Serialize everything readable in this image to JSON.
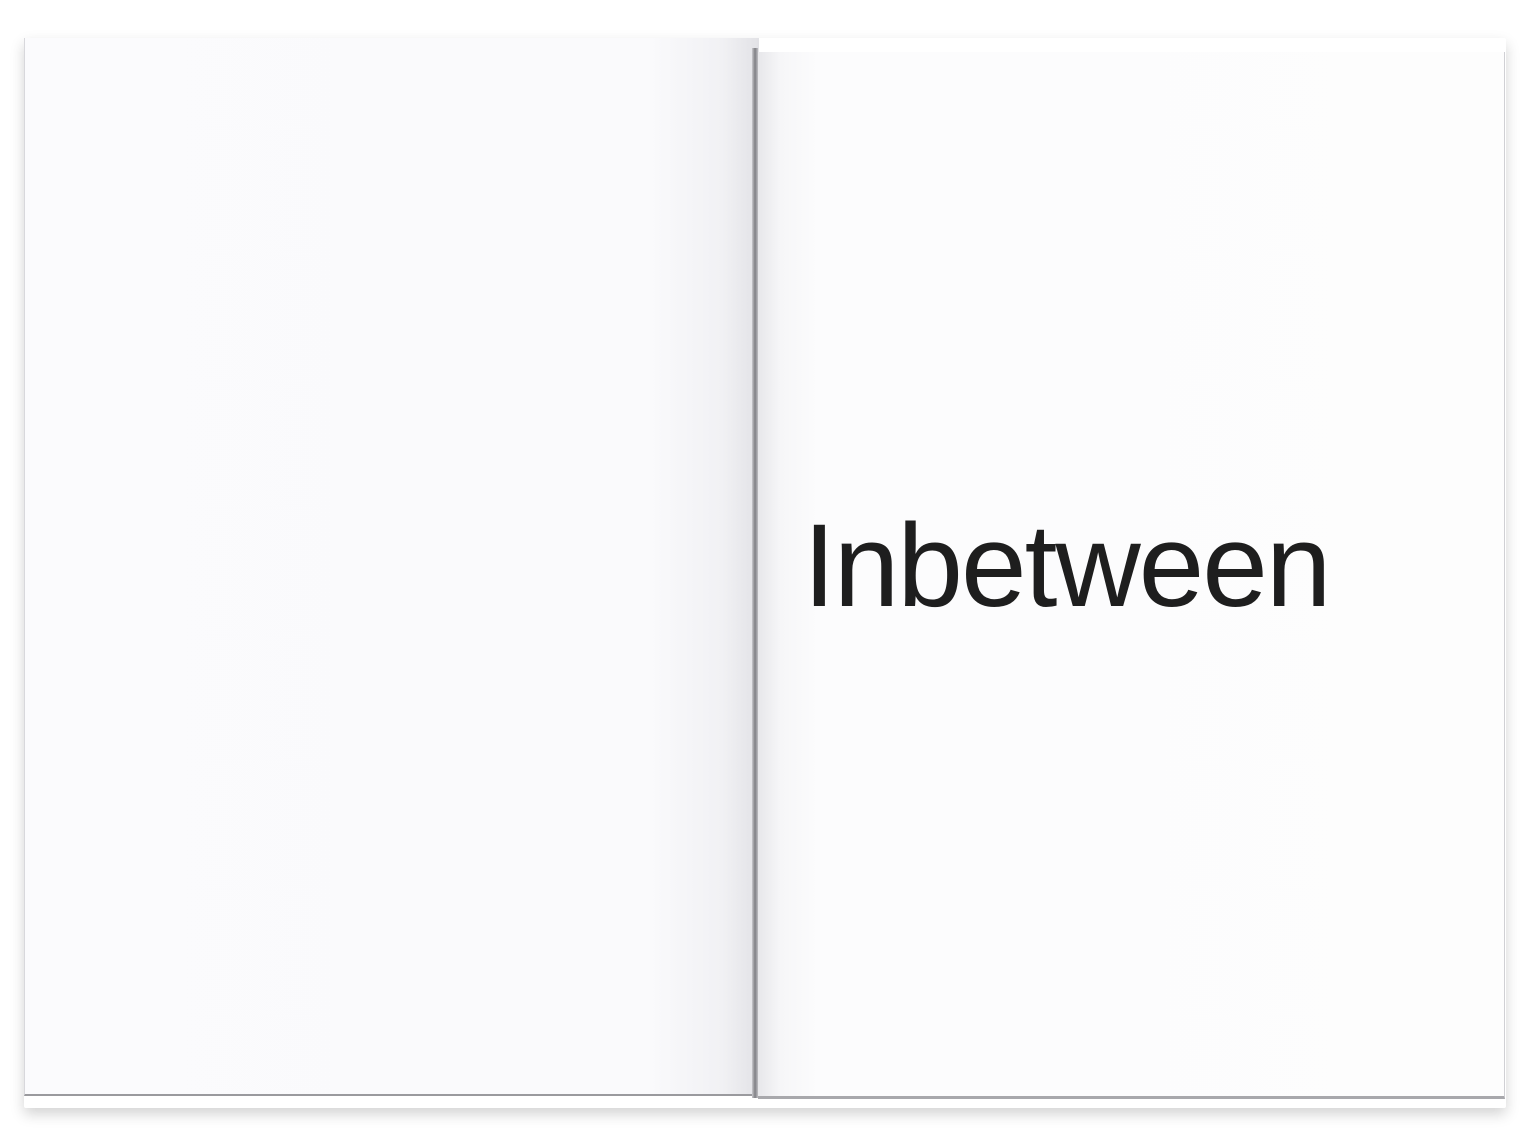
{
  "document": {
    "title": "Inbetween"
  },
  "colors": {
    "paper": "#fdfdfd",
    "text": "#1e1e1e"
  }
}
